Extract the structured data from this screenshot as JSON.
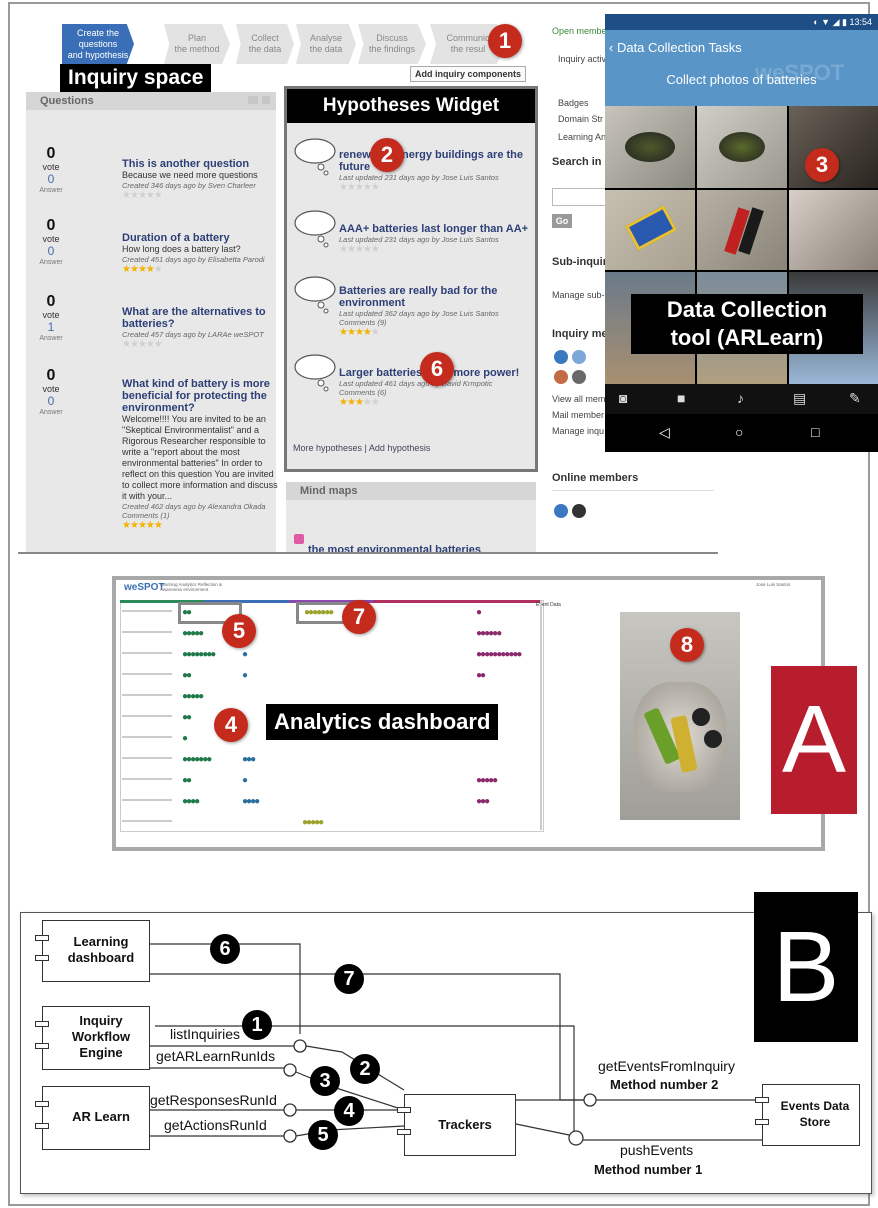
{
  "workflow_steps": [
    {
      "line1": "Create the questions",
      "line2": "and hypothesis"
    },
    {
      "line1": "Plan",
      "line2": "the method"
    },
    {
      "line1": "Collect",
      "line2": "the data"
    },
    {
      "line1": "Analyse",
      "line2": "the data"
    },
    {
      "line1": "Discuss",
      "line2": "the findings"
    },
    {
      "line1": "Communic",
      "line2": "the resul"
    }
  ],
  "labels": {
    "inquiry_space": "Inquiry space",
    "hypotheses_widget": "Hypotheses Widget",
    "data_collection_tool_line1": "Data Collection",
    "data_collection_tool_line2": "tool (ARLearn)",
    "analytics_dashboard": "Analytics dashboard",
    "panel_a": "A",
    "panel_b": "B"
  },
  "badges": [
    "1",
    "2",
    "3",
    "4",
    "5",
    "6",
    "7",
    "8"
  ],
  "add_inquiry_components": "Add inquiry components",
  "questions": {
    "header": "Questions",
    "vote_label": "vote",
    "answer_label": "Answer",
    "items": [
      {
        "votes": "0",
        "answers": "0",
        "title": "This is another question",
        "desc": "Because we need more questions",
        "meta": "Created 346 days ago by Sven Charleer",
        "stars": 0
      },
      {
        "votes": "0",
        "answers": "0",
        "title": "Duration of a battery",
        "desc": "How long does a battery last?",
        "meta": "Created 451 days ago by Elisabetta Parodi",
        "stars": 4
      },
      {
        "votes": "0",
        "answers": "1",
        "title": "What are the alternatives to batteries?",
        "desc": "",
        "meta": "Created 457 days ago by LARAe weSPOT",
        "stars": 0
      },
      {
        "votes": "0",
        "answers": "0",
        "title": "What kind of battery is more beneficial for protecting the environment?",
        "desc": "Welcome!!!! You are invited to be an \"Skeptical Environmentalist\" and a Rigorous Researcher responsible to write a \"report about the most environmental batteries\" In order to reflect on this question You are invited to collect more information and discuss it with your...",
        "meta": "Created 462 days ago by Alexandra Okada",
        "comments": "Comments (1)",
        "stars": 5
      }
    ]
  },
  "hypotheses": {
    "items": [
      {
        "title": "renewable energy buildings are the future",
        "meta": "Last updated 231 days ago by Jose Luis Santos",
        "comments": "",
        "stars": 0
      },
      {
        "title": "AAA+ batteries last longer than AA+",
        "meta": "Last updated 231 days ago by Jose Luis Santos",
        "comments": "",
        "stars": 0
      },
      {
        "title": "Batteries are really bad for the environment",
        "meta": "Last updated 362 days ago by Jose Luis Santos",
        "comments": "Comments (9)",
        "stars": 4
      },
      {
        "title": "Larger batteries have more power!",
        "meta": "Last updated 461 days ago by David Krmpotic",
        "comments": "Comments (6)",
        "stars": 3
      }
    ],
    "footer": "More hypotheses | Add hypothesis"
  },
  "mind_maps": {
    "header": "Mind maps",
    "item": "the most environmental batteries"
  },
  "sidebar": {
    "open_members": "Open member",
    "inquiry_activity": "Inquiry activ",
    "badges": "Badges",
    "domain": "Domain Str",
    "learning": "Learning An",
    "search_head": "Search in",
    "go": "Go",
    "subinquiries": "Sub-inquiri",
    "manage_sub": "Manage sub-",
    "inquiry_members": "Inquiry me",
    "view_all": "View all mem",
    "mail_members": "Mail member",
    "manage_inq": "Manage inqu",
    "online_members": "Online members"
  },
  "phone": {
    "status_time": "13:54",
    "title": "Data Collection Tasks",
    "task": "Collect photos of batteries",
    "watermark": "weSPOT"
  },
  "dashboard": {
    "logo": "weSPOT",
    "subtitle_line1": "Learning Analytics Reflection &",
    "subtitle_line2": "Awareness environment",
    "phase_header": "Event Data",
    "user": "Jose Luis Santos"
  },
  "diagram": {
    "components": {
      "learning_dashboard": "Learning dashboard",
      "inquiry_workflow_engine": "Inquiry Workflow Engine",
      "ar_learn": "AR Learn",
      "trackers": "Trackers",
      "events_data_store": "Events Data Store"
    },
    "edges": {
      "list_inquiries": "listInquiries",
      "get_arlearn_run_ids": "getARLearnRunIds",
      "get_responses_run_id": "getResponsesRunId",
      "get_actions_run_id": "getActionsRunId",
      "get_events_from_inquiry": "getEventsFromInquiry",
      "method_2": "Method number 2",
      "push_events": "pushEvents",
      "method_1": "Method number 1"
    }
  },
  "colors": {
    "step_active": "#3a6fb7",
    "badge_red": "#c42b1c",
    "panel_a_bg": "#b81d2e",
    "dot_green": "#1f7a4a",
    "dot_blue": "#2a6ea0",
    "dot_purple": "#8a2a6c",
    "dot_olive": "#9aa22a",
    "phone_header": "#5a95c8"
  }
}
